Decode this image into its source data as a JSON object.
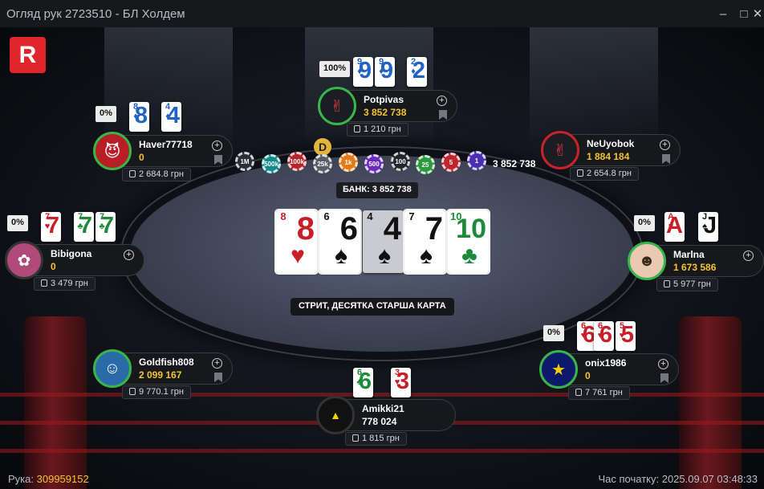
{
  "window": {
    "title": "Огляд рук 2723510 - БЛ Холдем"
  },
  "brand": {
    "logo_letter": "R",
    "accent": "#e0262c"
  },
  "pot": {
    "chips": [
      "1M",
      "500k",
      "100k",
      "25k",
      "1k",
      "500",
      "100",
      "25",
      "5",
      "1"
    ],
    "total": "3 852 738",
    "label": "БАНК: 3 852 738"
  },
  "dealer_label": "D",
  "board": [
    {
      "rank": "8",
      "suit": "♥",
      "color": "red"
    },
    {
      "rank": "6",
      "suit": "♠",
      "color": "black"
    },
    {
      "rank": "4",
      "suit": "♠",
      "color": "black"
    },
    {
      "rank": "7",
      "suit": "♠",
      "color": "black"
    },
    {
      "rank": "10",
      "suit": "♣",
      "color": "green"
    }
  ],
  "result_text": "СТРИТ, ДЕСЯТКА СТАРША КАРТА",
  "players": {
    "potpivas": {
      "name": "Potpivas",
      "stack": "3 852 738",
      "win": "1 210 грн",
      "equity": "100%",
      "cards": [
        {
          "rank": "9",
          "suit": "♦"
        },
        {
          "rank": "2",
          "suit": "♦"
        }
      ]
    },
    "haver": {
      "name": "Haver77718",
      "stack": "0",
      "win": "2 684.8 грн",
      "equity": "0%",
      "cards": [
        {
          "rank": "8",
          "suit": "♦"
        },
        {
          "rank": "4",
          "suit": "♦"
        }
      ]
    },
    "neuyobok": {
      "name": "NeUyobok",
      "stack": "1 884 184",
      "win": "2 654.8 грн"
    },
    "bibigona": {
      "name": "Bibigona",
      "stack": "0",
      "win": "3 479 грн",
      "equity": "0%",
      "cards": [
        {
          "rank": "7",
          "suit": "♥"
        },
        {
          "rank": "7",
          "suit": "♣"
        }
      ]
    },
    "marina": {
      "name": "Marlna",
      "stack": "1 673 586",
      "win": "5 977 грн",
      "equity": "0%",
      "cards": [
        {
          "rank": "A",
          "suit": "♥"
        },
        {
          "rank": "J",
          "suit": "♠"
        }
      ]
    },
    "goldfish": {
      "name": "Goldfish808",
      "stack": "2 099 167",
      "win": "9 770.1 грн"
    },
    "onix": {
      "name": "onix1986",
      "stack": "0",
      "win": "7 761 грн",
      "equity": "0%",
      "cards": [
        {
          "rank": "6",
          "suit": "♥"
        },
        {
          "rank": "5",
          "suit": "♥"
        }
      ]
    },
    "amikki": {
      "name": "Amikki21",
      "stack": "778 024",
      "win": "1 815 грн",
      "cards": [
        {
          "rank": "6",
          "suit": "♣"
        },
        {
          "rank": "3",
          "suit": "♥"
        }
      ]
    }
  },
  "footer": {
    "hand_label": "Рука:",
    "hand_id": "309959152",
    "start_label": "Час початку:",
    "start_time": "2025.09.07 03:48:33"
  }
}
